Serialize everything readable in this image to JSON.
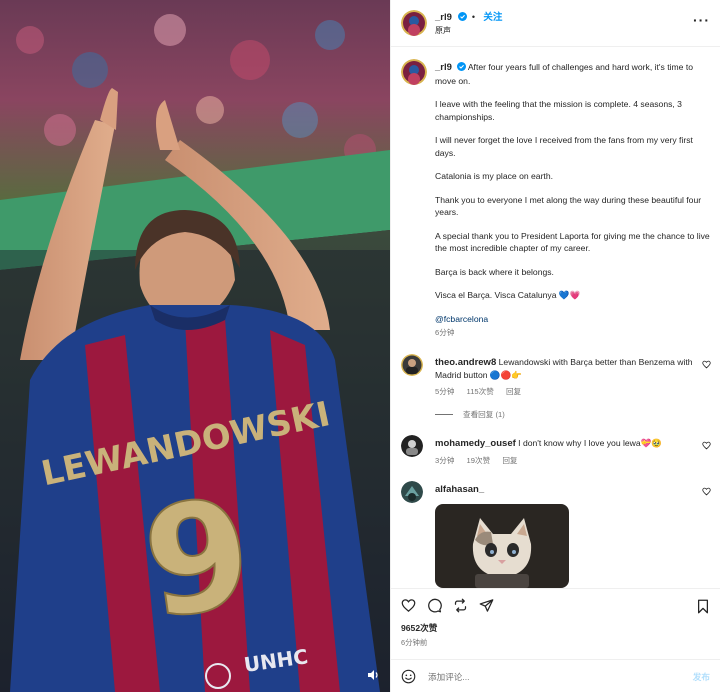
{
  "header": {
    "username": "_rl9",
    "follow_label": "关注",
    "audio_label": "原声",
    "more_icon": "more-horizontal-icon"
  },
  "caption": {
    "username": "_rl9",
    "paragraphs": [
      "After four years full of challenges and hard work, it's time to move on.",
      "I leave with the feeling that the mission is complete. 4 seasons, 3 championships.",
      "I will never forget the love I received from the fans from my very first days.",
      "Catalonia is my place on earth.",
      "Thank you to everyone I met along the way during these beautiful four years.",
      "A special thank you to President Laporta for giving me the chance to live the most incredible chapter of my career.",
      "Barça is back where it belongs.",
      "Visca el Barça. Visca Catalunya 💙💗"
    ],
    "mention": "@fcbarcelona",
    "time": "6分钟"
  },
  "comments": [
    {
      "username": "theo.andrew8",
      "text": "Lewandowski with Barça better than Benzema with Madrid button 🔵🔴👉",
      "time": "5分钟",
      "likes": "115次赞",
      "reply_label": "回复",
      "view_replies": "查看回复 (1)"
    },
    {
      "username": "mohamedy_ousef",
      "text": "I don't know why I love you lewa💝🥹",
      "time": "3分钟",
      "likes": "19次赞",
      "reply_label": "回复"
    },
    {
      "username": "alfahasan_"
    }
  ],
  "actions": {
    "likes": "9652次赞",
    "time": "6分钟前"
  },
  "add_comment": {
    "placeholder": "添加评论...",
    "post_label": "发布"
  },
  "media": {
    "jersey_name": "LEWANDOWSKI",
    "jersey_number": "9",
    "sponsor": "UNHCR ACNUR"
  },
  "colors": {
    "accent": "#0095f6",
    "muted": "#737373",
    "text": "#262626",
    "post_disabled": "#b2dffc"
  }
}
